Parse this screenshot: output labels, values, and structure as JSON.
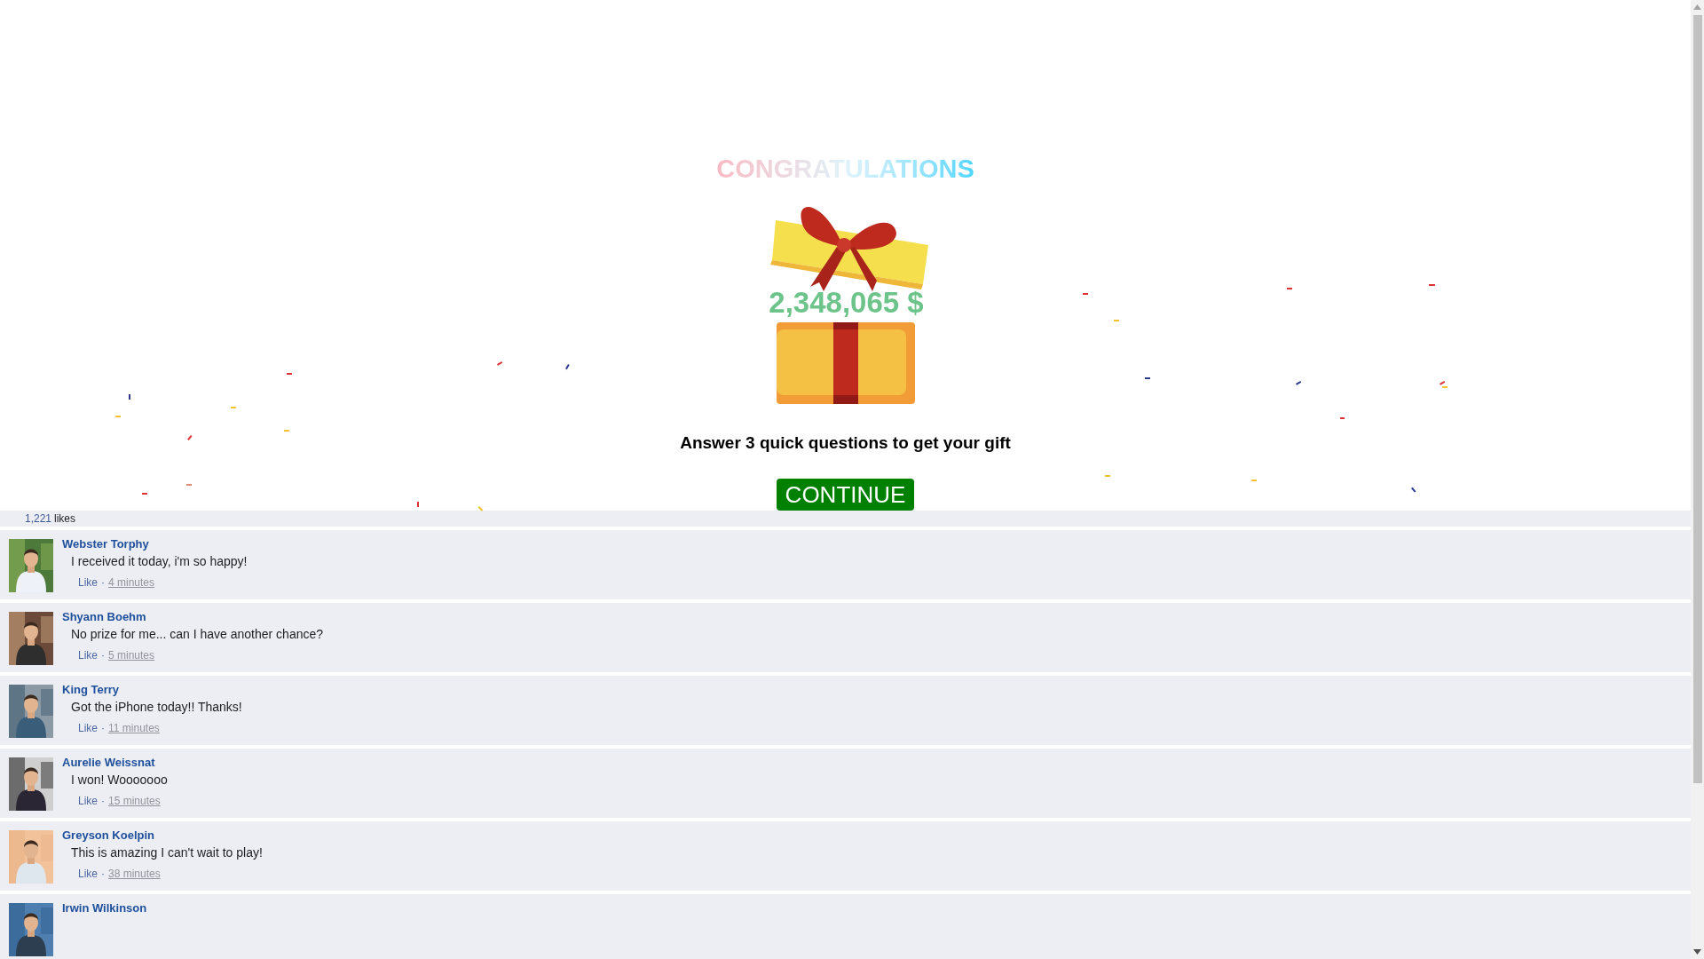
{
  "title": "CONGRATULATIONS",
  "amount": "2,348,065 $",
  "prompt": "Answer 3 quick questions to get your gift",
  "button": "CONTINUE",
  "likes": {
    "count": "1,221",
    "label": "likes"
  },
  "comments": [
    {
      "name": "Webster Torphy",
      "text": "I received it today, i'm so happy!",
      "like": "Like",
      "dot": "·",
      "time": "4 minutes"
    },
    {
      "name": "Shyann Boehm",
      "text": "No prize for me... can I have another chance?",
      "like": "Like",
      "dot": "·",
      "time": "5 minutes"
    },
    {
      "name": "King Terry",
      "text": "Got the iPhone today!! Thanks!",
      "like": "Like",
      "dot": "·",
      "time": "11 minutes"
    },
    {
      "name": "Aurelie Weissnat",
      "text": "I won! Wooooooo",
      "like": "Like",
      "dot": "·",
      "time": "15 minutes"
    },
    {
      "name": "Greyson Koelpin",
      "text": "This is amazing I can't wait to play!",
      "like": "Like",
      "dot": "·",
      "time": "38 minutes"
    },
    {
      "name": "Irwin Wilkinson"
    }
  ]
}
